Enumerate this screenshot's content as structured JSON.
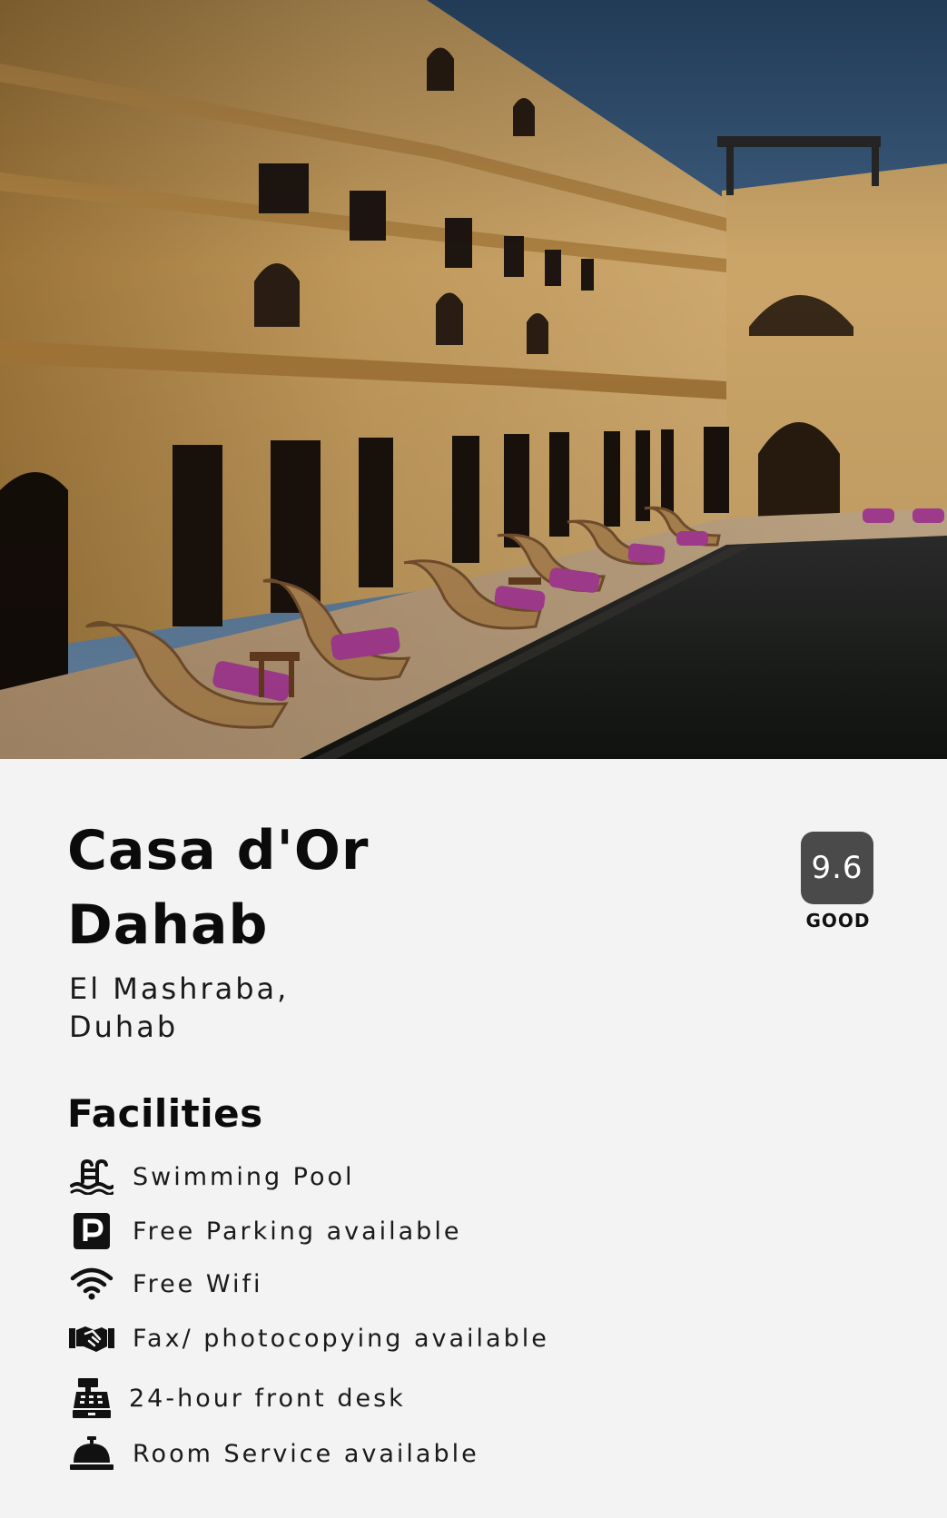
{
  "hero": {
    "image_alt": "Hotel courtyard with pool and lounge chairs"
  },
  "hotel": {
    "name_line1": "Casa d'Or",
    "name_line2": "Dahab",
    "location_line1": "El Mashraba,",
    "location_line2": "Duhab"
  },
  "rating": {
    "score": "9.6",
    "label": "GOOD"
  },
  "facilities": {
    "heading": "Facilities",
    "items": [
      {
        "icon": "swimming-pool-icon",
        "label": "Swimming Pool"
      },
      {
        "icon": "parking-icon",
        "label": "Free Parking available"
      },
      {
        "icon": "wifi-icon",
        "label": "Free Wifi"
      },
      {
        "icon": "handshake-icon",
        "label": "Fax/ photocopying available"
      },
      {
        "icon": "cash-register-icon",
        "label": "24-hour front desk"
      },
      {
        "icon": "service-bell-icon",
        "label": "Room Service available"
      }
    ]
  }
}
